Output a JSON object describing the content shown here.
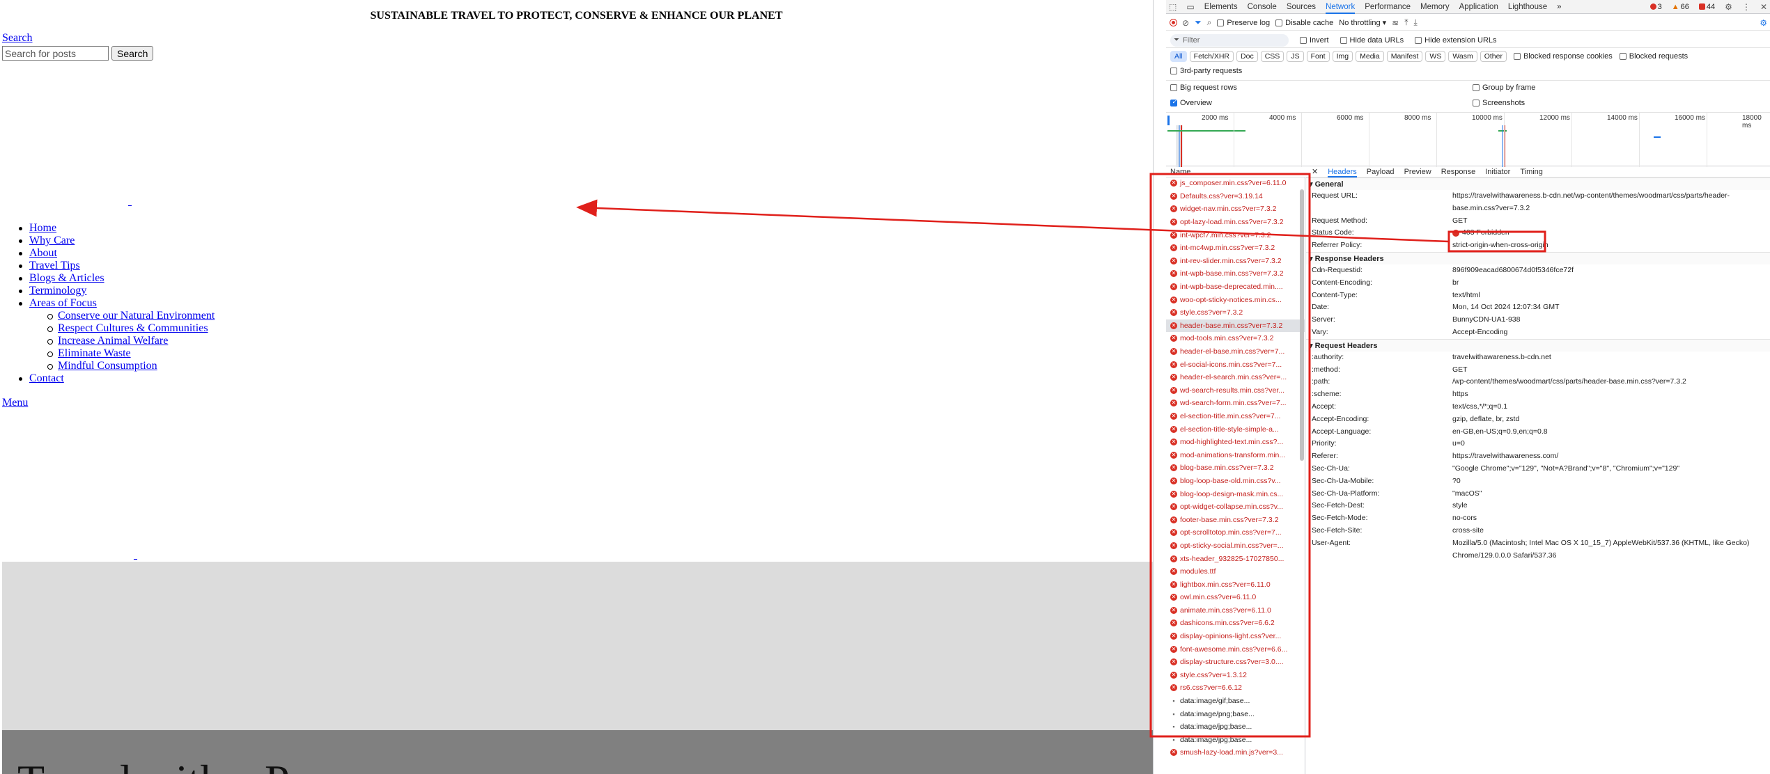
{
  "site": {
    "banner": "SUSTAINABLE TRAVEL TO PROTECT, CONSERVE & ENHANCE OUR PLANET",
    "search_link": "Search",
    "search_placeholder": "Search for posts",
    "search_button": "Search",
    "tiny_link_1": "_",
    "tiny_link_2": "_",
    "nav": [
      "Home",
      "Why Care",
      "About",
      "Travel Tips",
      "Blogs & Articles",
      "Terminology",
      "Areas of Focus"
    ],
    "sub_nav": [
      "Conserve our Natural Environment",
      "Respect Cultures & Communities",
      "Increase Animal Welfare",
      "Eliminate Waste",
      "Mindful Consumption"
    ],
    "nav_last": "Contact",
    "menu_link": "Menu",
    "hero_text": "Travel with a P"
  },
  "devtools": {
    "tabs": [
      "Elements",
      "Console",
      "Sources",
      "Network",
      "Performance",
      "Memory",
      "Application",
      "Lighthouse"
    ],
    "more_tabs": "»",
    "counts": {
      "errors": "3",
      "warnings": "66",
      "issues": "44"
    },
    "toolbar": {
      "preserve_log": "Preserve log",
      "disable_cache": "Disable cache",
      "throttling": "No throttling ▾"
    },
    "filter": {
      "placeholder": "Filter",
      "invert": "Invert",
      "hide_data_urls": "Hide data URLs",
      "hide_ext_urls": "Hide extension URLs"
    },
    "types": [
      "All",
      "Fetch/XHR",
      "Doc",
      "CSS",
      "JS",
      "Font",
      "Img",
      "Media",
      "Manifest",
      "WS",
      "Wasm",
      "Other"
    ],
    "blocked_cookies": "Blocked response cookies",
    "blocked_requests": "Blocked requests",
    "third_party": "3rd-party requests",
    "big_rows": "Big request rows",
    "group_by_frame": "Group by frame",
    "overview": "Overview",
    "screenshots": "Screenshots",
    "timeline_ticks": [
      "2000 ms",
      "4000 ms",
      "6000 ms",
      "8000 ms",
      "10000 ms",
      "12000 ms",
      "14000 ms",
      "16000 ms",
      "18000 ms"
    ],
    "name_header": "Name",
    "requests": [
      {
        "name": "js_composer.min.css?ver=6.11.0",
        "err": true
      },
      {
        "name": "Defaults.css?ver=3.19.14",
        "err": true
      },
      {
        "name": "widget-nav.min.css?ver=7.3.2",
        "err": true
      },
      {
        "name": "opt-lazy-load.min.css?ver=7.3.2",
        "err": true
      },
      {
        "name": "int-wpcf7.min.css?ver=7.3.2",
        "err": true
      },
      {
        "name": "int-mc4wp.min.css?ver=7.3.2",
        "err": true
      },
      {
        "name": "int-rev-slider.min.css?ver=7.3.2",
        "err": true
      },
      {
        "name": "int-wpb-base.min.css?ver=7.3.2",
        "err": true
      },
      {
        "name": "int-wpb-base-deprecated.min....",
        "err": true
      },
      {
        "name": "woo-opt-sticky-notices.min.cs...",
        "err": true
      },
      {
        "name": "style.css?ver=7.3.2",
        "err": true
      },
      {
        "name": "header-base.min.css?ver=7.3.2",
        "err": true,
        "sel": true
      },
      {
        "name": "mod-tools.min.css?ver=7.3.2",
        "err": true
      },
      {
        "name": "header-el-base.min.css?ver=7...",
        "err": true
      },
      {
        "name": "el-social-icons.min.css?ver=7...",
        "err": true
      },
      {
        "name": "header-el-search.min.css?ver=...",
        "err": true
      },
      {
        "name": "wd-search-results.min.css?ver...",
        "err": true
      },
      {
        "name": "wd-search-form.min.css?ver=7...",
        "err": true
      },
      {
        "name": "el-section-title.min.css?ver=7...",
        "err": true
      },
      {
        "name": "el-section-title-style-simple-a...",
        "err": true
      },
      {
        "name": "mod-highlighted-text.min.css?...",
        "err": true
      },
      {
        "name": "mod-animations-transform.min...",
        "err": true
      },
      {
        "name": "blog-base.min.css?ver=7.3.2",
        "err": true
      },
      {
        "name": "blog-loop-base-old.min.css?v...",
        "err": true
      },
      {
        "name": "blog-loop-design-mask.min.cs...",
        "err": true
      },
      {
        "name": "opt-widget-collapse.min.css?v...",
        "err": true
      },
      {
        "name": "footer-base.min.css?ver=7.3.2",
        "err": true
      },
      {
        "name": "opt-scrolltotop.min.css?ver=7...",
        "err": true
      },
      {
        "name": "opt-sticky-social.min.css?ver=...",
        "err": true
      },
      {
        "name": "xts-header_932825-17027850...",
        "err": true
      },
      {
        "name": "modules.ttf",
        "err": true
      },
      {
        "name": "lightbox.min.css?ver=6.11.0",
        "err": true
      },
      {
        "name": "owl.min.css?ver=6.11.0",
        "err": true
      },
      {
        "name": "animate.min.css?ver=6.11.0",
        "err": true
      },
      {
        "name": "dashicons.min.css?ver=6.6.2",
        "err": true
      },
      {
        "name": "display-opinions-light.css?ver...",
        "err": true
      },
      {
        "name": "font-awesome.min.css?ver=6.6...",
        "err": true
      },
      {
        "name": "display-structure.css?ver=3.0....",
        "err": true
      },
      {
        "name": "style.css?ver=1.3.12",
        "err": true
      },
      {
        "name": "rs6.css?ver=6.6.12",
        "err": true
      },
      {
        "name": "data:image/gif;base...",
        "err": false
      },
      {
        "name": "data:image/png;base...",
        "err": false
      },
      {
        "name": "data:image/jpg;base...",
        "err": false
      },
      {
        "name": "data:image/jpg;base...",
        "err": false
      },
      {
        "name": "smush-lazy-load.min.js?ver=3...",
        "err": true
      }
    ],
    "detail_tabs": [
      "Headers",
      "Payload",
      "Preview",
      "Response",
      "Initiator",
      "Timing"
    ],
    "general_title": "General",
    "general": [
      {
        "k": "Request URL:",
        "v": "https://travelwithawareness.b-cdn.net/wp-content/themes/woodmart/css/parts/header-base.min.css?ver=7.3.2"
      },
      {
        "k": "Request Method:",
        "v": "GET"
      },
      {
        "k": "Status Code:",
        "v": "403 Forbidden"
      },
      {
        "k": "Referrer Policy:",
        "v": "strict-origin-when-cross-origin"
      }
    ],
    "response_title": "Response Headers",
    "response": [
      {
        "k": "Cdn-Requestid:",
        "v": "896f909eacad6800674d0f5346fce72f"
      },
      {
        "k": "Content-Encoding:",
        "v": "br"
      },
      {
        "k": "Content-Type:",
        "v": "text/html"
      },
      {
        "k": "Date:",
        "v": "Mon, 14 Oct 2024 12:07:34 GMT"
      },
      {
        "k": "Server:",
        "v": "BunnyCDN-UA1-938"
      },
      {
        "k": "Vary:",
        "v": "Accept-Encoding"
      }
    ],
    "request_title": "Request Headers",
    "request": [
      {
        "k": ":authority:",
        "v": "travelwithawareness.b-cdn.net"
      },
      {
        "k": ":method:",
        "v": "GET"
      },
      {
        "k": ":path:",
        "v": "/wp-content/themes/woodmart/css/parts/header-base.min.css?ver=7.3.2"
      },
      {
        "k": ":scheme:",
        "v": "https"
      },
      {
        "k": "Accept:",
        "v": "text/css,*/*;q=0.1"
      },
      {
        "k": "Accept-Encoding:",
        "v": "gzip, deflate, br, zstd"
      },
      {
        "k": "Accept-Language:",
        "v": "en-GB,en-US;q=0.9,en;q=0.8"
      },
      {
        "k": "Priority:",
        "v": "u=0"
      },
      {
        "k": "Referer:",
        "v": "https://travelwithawareness.com/"
      },
      {
        "k": "Sec-Ch-Ua:",
        "v": "\"Google Chrome\";v=\"129\", \"Not=A?Brand\";v=\"8\", \"Chromium\";v=\"129\""
      },
      {
        "k": "Sec-Ch-Ua-Mobile:",
        "v": "?0"
      },
      {
        "k": "Sec-Ch-Ua-Platform:",
        "v": "\"macOS\""
      },
      {
        "k": "Sec-Fetch-Dest:",
        "v": "style"
      },
      {
        "k": "Sec-Fetch-Mode:",
        "v": "no-cors"
      },
      {
        "k": "Sec-Fetch-Site:",
        "v": "cross-site"
      },
      {
        "k": "User-Agent:",
        "v": "Mozilla/5.0 (Macintosh; Intel Mac OS X 10_15_7) AppleWebKit/537.36 (KHTML, like Gecko) Chrome/129.0.0.0 Safari/537.36"
      }
    ]
  },
  "colors": {
    "annotation": "#e0201b",
    "error": "#d93025",
    "accent": "#1a73e8"
  }
}
